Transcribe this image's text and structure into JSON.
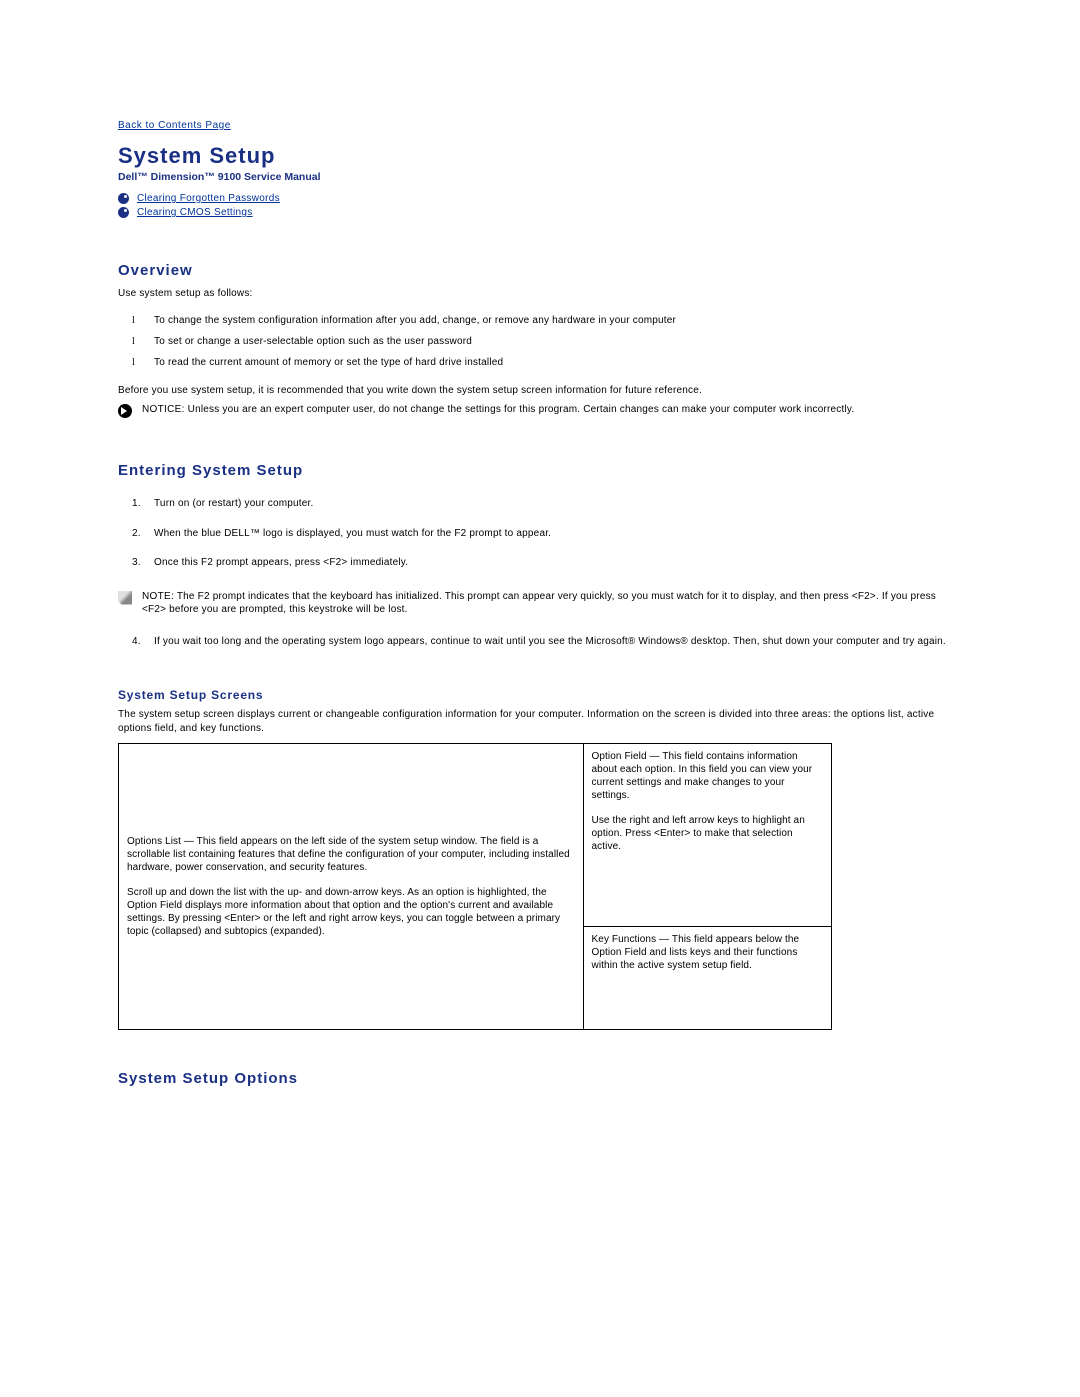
{
  "nav": {
    "back_link": "Back to Contents Page"
  },
  "title": "System Setup",
  "subtitle": "Dell™ Dimension™ 9100 Service Manual",
  "toc_links": [
    "Clearing Forgotten Passwords",
    "Clearing CMOS Settings"
  ],
  "overview": {
    "heading": "Overview",
    "intro": "Use system setup as follows:",
    "items": [
      "To change the system configuration information after you add, change, or remove any hardware in your computer",
      "To set or change a user-selectable option such as the user password",
      "To read the current amount of memory or set the type of hard drive installed"
    ],
    "recommend": "Before you use system setup, it is recommended that you write down the system setup screen information for future reference.",
    "notice_lead": "NOTICE:",
    "notice_body": " Unless you are an expert computer user, do not change the settings for this program. Certain changes can make your computer work incorrectly."
  },
  "entering": {
    "heading": "Entering System Setup",
    "steps_first": [
      "Turn on (or restart) your computer.",
      "When the blue DELL™ logo is displayed, you must watch for the F2 prompt to appear.",
      "Once this F2 prompt appears, press <F2> immediately."
    ],
    "note_lead": "NOTE:",
    "note_body": " The F2 prompt indicates that the keyboard has initialized. This prompt can appear very quickly, so you must watch for it to display, and then press <F2>. If you press <F2> before you are prompted, this keystroke will be lost.",
    "steps_second": [
      "If you wait too long and the operating system logo appears, continue to wait until you see the Microsoft® Windows® desktop. Then, shut down your computer and try again."
    ]
  },
  "screens": {
    "heading": "System Setup Screens",
    "intro": "The system setup screen displays current or changeable configuration information for your computer. Information on the screen is divided into three areas: the options list, active options field, and key functions.",
    "left": {
      "p1": "Options List — This field appears on the left side of the system setup window. The field is a scrollable list containing features that define the configuration of your computer, including installed hardware, power conservation, and security features.",
      "p2": "Scroll up and down the list with the up- and down-arrow keys. As an option is highlighted, the Option Field displays more information about that option and the option's current and available settings. By pressing <Enter> or the left and right arrow keys, you can toggle between a primary topic (collapsed) and subtopics (expanded)."
    },
    "right_top": {
      "p1": "Option Field — This field contains information about each option. In this field you can view your current settings and make changes to your settings.",
      "p2": "Use the right and left arrow keys to highlight an option. Press <Enter> to make that selection active."
    },
    "right_bottom": {
      "p1": "Key Functions — This field appears below the Option Field and lists keys and their functions within the active system setup field."
    }
  },
  "options": {
    "heading": "System Setup Options"
  }
}
